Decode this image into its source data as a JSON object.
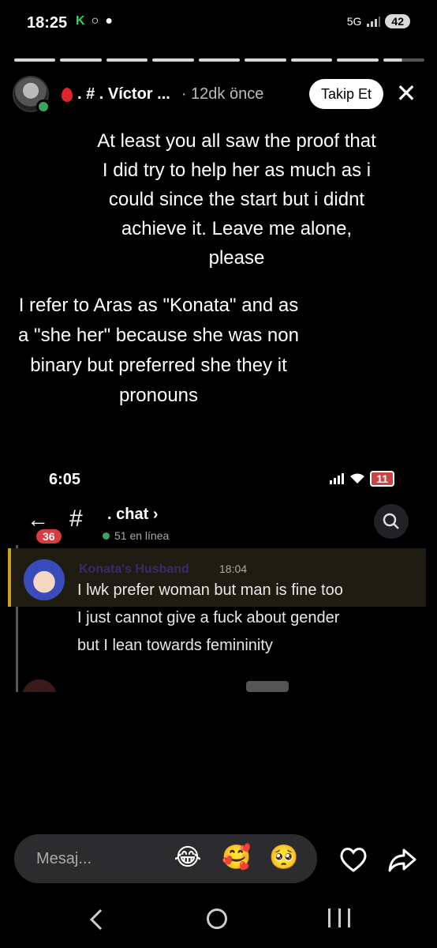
{
  "status_bar": {
    "time": "18:25",
    "left_icons": [
      "K",
      "○",
      "●"
    ],
    "network": "5G",
    "battery": "42"
  },
  "story": {
    "segments_total": 9,
    "segments_viewed": 8,
    "username": ". # . Víctor ...",
    "ago": "· 12dk önce",
    "follow_label": "Takip Et",
    "close_label": "✕"
  },
  "captions": {
    "top": "At least you all saw the proof that I did try to help her as much as i could since the start but i didnt achieve it. Leave me alone, please",
    "bottom": "I refer to Aras as \"Konata\" and as a \"she her\" because she was non binary but preferred she they it pronouns"
  },
  "embedded": {
    "status": {
      "time": "6:05",
      "battery": "11"
    },
    "chat": {
      "back_badge": "36",
      "channel_name": ". chat",
      "chevron": "›",
      "online_count": "51 en línea",
      "message": {
        "author": "Konata's Husband",
        "time": "18:04",
        "lines": [
          "I lwk prefer woman but man is fine too",
          "I just cannot give a fuck about gender",
          "but I lean towards femininity"
        ]
      }
    }
  },
  "composer": {
    "placeholder": "Mesaj...",
    "emojis": [
      "😂",
      "🥰",
      "🥺"
    ]
  }
}
